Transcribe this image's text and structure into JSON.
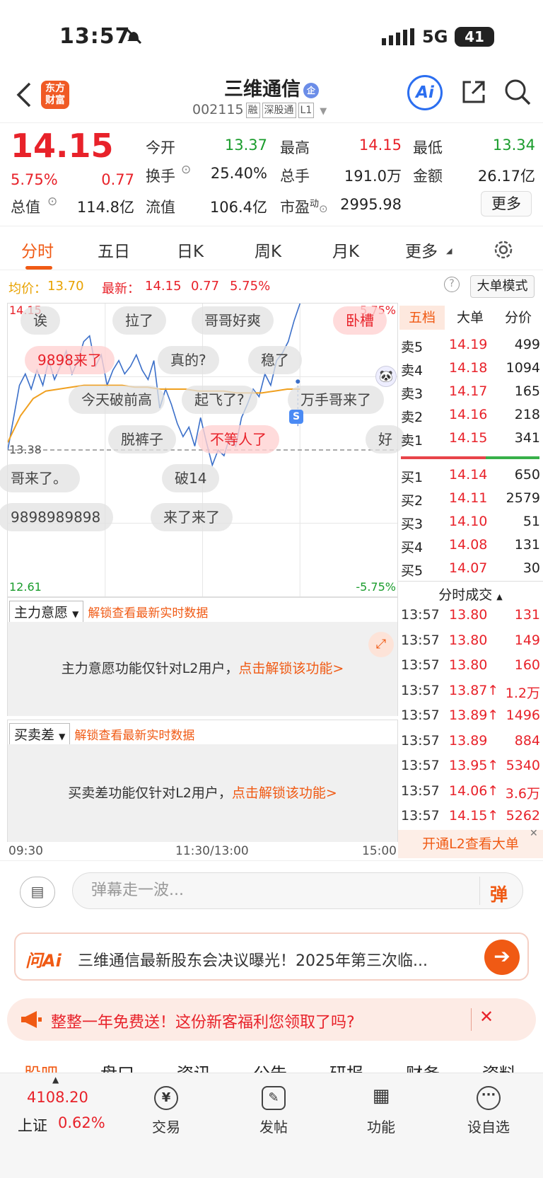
{
  "status_bar": {
    "time": "13:57",
    "network": "5G",
    "battery": "41"
  },
  "header": {
    "logo_line1": "东方",
    "logo_line2": "财富",
    "stock_name": "三维通信",
    "badge": "企",
    "code": "002115",
    "tags": [
      "融",
      "深股通",
      "L1"
    ],
    "ai_label": "Ai"
  },
  "quote": {
    "price": "14.15",
    "pct": "5.75%",
    "change": "0.77",
    "open_label": "今开",
    "open": "13.37",
    "high_label": "最高",
    "high": "14.15",
    "low_label": "最低",
    "low": "13.34",
    "turnover_label": "换手",
    "turnover": "25.40%",
    "volume_label": "总手",
    "volume": "191.0万",
    "amount_label": "金额",
    "amount": "26.17亿",
    "mcap_label": "总值",
    "mcap": "114.8亿",
    "float_label": "流值",
    "float": "106.4亿",
    "pe_label": "市盈",
    "pe_sup": "动",
    "pe": "2995.98",
    "more": "更多"
  },
  "tabs": [
    "分时",
    "五日",
    "日K",
    "周K",
    "月K",
    "更多"
  ],
  "avg_row": {
    "avg_label": "均价：",
    "avg": "13.70",
    "last_label": "最新：",
    "last": "14.15",
    "chg": "0.77",
    "pct": "5.75%",
    "big_order_mode": "大单模式"
  },
  "chart_axis": {
    "top_price": "14.15",
    "top_pct": "5.75%",
    "mid_price": "13.38",
    "bottom_price": "12.61",
    "bottom_pct": "-5.75%"
  },
  "chart_data": {
    "type": "line",
    "x_range": [
      "09:30",
      "15:00"
    ],
    "ylim": [
      12.61,
      14.15
    ],
    "reference": 13.38,
    "series": [
      {
        "values": [
          13.38,
          13.55,
          13.72,
          13.78,
          13.7,
          13.8,
          13.72,
          13.85,
          13.75,
          13.82,
          13.9,
          13.78,
          13.85,
          13.95,
          13.98,
          13.82,
          13.88,
          13.72,
          13.8,
          13.85,
          13.78,
          13.82,
          13.88,
          13.8,
          13.75,
          13.85,
          13.6,
          13.7,
          13.62,
          13.52,
          13.45,
          13.5,
          13.4,
          13.55,
          13.42,
          13.3,
          13.38,
          13.35,
          13.45,
          13.4,
          13.55,
          13.62,
          13.7,
          13.66,
          13.78,
          13.72,
          13.85,
          13.89,
          13.95,
          14.06,
          14.15
        ]
      },
      {
        "values": [
          13.42,
          13.56,
          13.65,
          13.69,
          13.7,
          13.71,
          13.72,
          13.72,
          13.72,
          13.72,
          13.71,
          13.71,
          13.7,
          13.7,
          13.7,
          13.69,
          13.69,
          13.69,
          13.68,
          13.68,
          13.68,
          13.69,
          13.7,
          13.7
        ]
      }
    ]
  },
  "danmaku": [
    {
      "text": "诶",
      "hot": false
    },
    {
      "text": "拉了",
      "hot": false
    },
    {
      "text": "哥哥好爽",
      "hot": false
    },
    {
      "text": "卧槽",
      "hot": true
    },
    {
      "text": "9898来了",
      "hot": true
    },
    {
      "text": "真的?",
      "hot": false
    },
    {
      "text": "稳了",
      "hot": false
    },
    {
      "text": "今天破前高",
      "hot": false
    },
    {
      "text": "起飞了?",
      "hot": false
    },
    {
      "text": "万手哥来了",
      "hot": false
    },
    {
      "text": "脱裤子",
      "hot": false
    },
    {
      "text": "不等人了",
      "hot": true
    },
    {
      "text": "好",
      "hot": false
    },
    {
      "text": "哥来了。",
      "hot": false
    },
    {
      "text": "破14",
      "hot": false
    },
    {
      "text": "9898989898",
      "hot": false
    },
    {
      "text": "来了来了",
      "hot": false
    }
  ],
  "order_book": {
    "tabs": [
      "五档",
      "大单",
      "分价"
    ],
    "asks": [
      [
        "卖5",
        "14.19",
        "499"
      ],
      [
        "卖4",
        "14.18",
        "1094"
      ],
      [
        "卖3",
        "14.17",
        "165"
      ],
      [
        "卖2",
        "14.16",
        "218"
      ],
      [
        "卖1",
        "14.15",
        "341"
      ]
    ],
    "bids": [
      [
        "买1",
        "14.14",
        "650"
      ],
      [
        "买2",
        "14.11",
        "2579"
      ],
      [
        "买3",
        "14.10",
        "51"
      ],
      [
        "买4",
        "14.08",
        "131"
      ],
      [
        "买5",
        "14.07",
        "30"
      ]
    ],
    "trades_title": "分时成交",
    "trades": [
      [
        "13:57",
        "13.80",
        "131"
      ],
      [
        "13:57",
        "13.80",
        "149"
      ],
      [
        "13:57",
        "13.80",
        "160"
      ],
      [
        "13:57",
        "13.87↑",
        "1.2万"
      ],
      [
        "13:57",
        "13.89↑",
        "1496"
      ],
      [
        "13:57",
        "13.89",
        "884"
      ],
      [
        "13:57",
        "13.95↑",
        "5340"
      ],
      [
        "13:57",
        "14.06↑",
        "3.6万"
      ],
      [
        "13:57",
        "14.15↑",
        "5262"
      ]
    ],
    "l2_promo": "开通L2查看大单"
  },
  "sub1": {
    "select": "主力意愿",
    "unlock": "解锁查看最新实时数据",
    "msg": "主力意愿功能仅针对L2用户，",
    "link": "点击解锁该功能>"
  },
  "sub2": {
    "select": "买卖差",
    "unlock": "解锁查看最新实时数据",
    "msg": "买卖差功能仅针对L2用户，",
    "link": "点击解锁该功能>"
  },
  "time_axis": {
    "start": "09:30",
    "mid": "11:30/13:00",
    "end": "15:00"
  },
  "danmu_input": {
    "placeholder": "弹幕走一波...",
    "send": "弹"
  },
  "ai_box": {
    "label": "问Ai",
    "text": "三维通信最新股东会决议曝光！2025年第三次临..."
  },
  "promo": {
    "text": "整整一年免费送！这份新客福利您领取了吗?"
  },
  "sub_tabs": [
    "股吧",
    "盘口",
    "资讯",
    "公告",
    "研报",
    "财务",
    "资料"
  ],
  "bottom_nav": {
    "index_value": "4108.20",
    "index_name": "上证",
    "index_pct": "0.62%",
    "items": [
      "交易",
      "发帖",
      "功能",
      "设自选"
    ]
  }
}
